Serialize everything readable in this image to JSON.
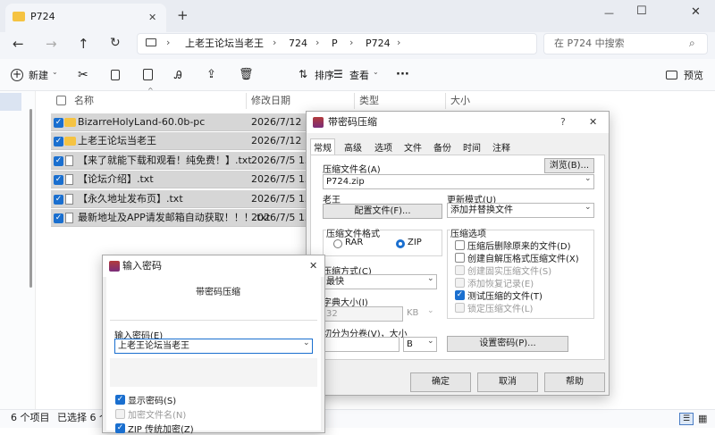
{
  "window": {
    "tab_title": "P724",
    "new_tab": "+",
    "minimize": "—",
    "maximize": "☐",
    "close": "✕"
  },
  "nav": {
    "breadcrumb": [
      "上老王论坛当老王",
      "724",
      "P",
      "P724"
    ],
    "search_placeholder": "在 P724 中搜索"
  },
  "commands": {
    "new": "新建",
    "sort": "排序",
    "view": "查看",
    "more": "···",
    "preview": "预览"
  },
  "columns": {
    "name": "名称",
    "date": "修改日期",
    "type": "类型",
    "size": "大小"
  },
  "files": [
    {
      "name": "BizarreHolyLand-60.0b-pc",
      "date": "2026/7/12 15:",
      "kind": "folder"
    },
    {
      "name": "上老王论坛当老王",
      "date": "2026/7/12 15:",
      "kind": "folder"
    },
    {
      "name": "【来了就能下载和观看！纯免费！】.txt",
      "date": "2026/7/5 13:1",
      "kind": "txt"
    },
    {
      "name": "【论坛介绍】.txt",
      "date": "2026/7/5 13:1",
      "kind": "txt"
    },
    {
      "name": "【永久地址发布页】.txt",
      "date": "2026/7/5 13:1",
      "kind": "txt"
    },
    {
      "name": "最新地址及APP请发邮箱自动获取！！！.txt",
      "date": "2026/7/5 13:1",
      "kind": "txt"
    }
  ],
  "status": {
    "count": "6 个项目",
    "selected": "已选择 6 个"
  },
  "rar": {
    "title": "带密码压缩",
    "help_q": "?",
    "close": "✕",
    "tabs": [
      "常规",
      "高级",
      "选项",
      "文件",
      "备份",
      "时间",
      "注释"
    ],
    "archive_name_label": "压缩文件名(A)",
    "browse": "浏览(B)...",
    "archive_name": "P724.zip",
    "profile_label": "老王",
    "profiles_btn": "配置文件(F)...",
    "update_label": "更新模式(U)",
    "update_value": "添加并替换文件",
    "format_label": "压缩文件格式",
    "format_rar": "RAR",
    "format_zip": "ZIP",
    "options_label": "压缩选项",
    "options": [
      {
        "label": "压缩后删除原来的文件(D)",
        "state": "off"
      },
      {
        "label": "创建自解压格式压缩文件(X)",
        "state": "off"
      },
      {
        "label": "创建固实压缩文件(S)",
        "state": "dis"
      },
      {
        "label": "添加恢复记录(E)",
        "state": "dis"
      },
      {
        "label": "测试压缩的文件(T)",
        "state": "on"
      },
      {
        "label": "锁定压缩文件(L)",
        "state": "dis"
      }
    ],
    "method_label": "压缩方式(C)",
    "method_value": "最快",
    "dict_label": "字典大小(I)",
    "dict_value": "32",
    "dict_unit": "KB",
    "split_label": "切分为分卷(V)，大小",
    "split_unit": "B",
    "set_password": "设置密码(P)...",
    "ok": "确定",
    "cancel": "取消",
    "help": "帮助"
  },
  "pwd": {
    "title": "输入密码",
    "close": "✕",
    "subtitle": "带密码压缩",
    "input_label": "输入密码(E)",
    "input_value": "上老王论坛当老王",
    "show_password": "显示密码(S)",
    "encrypt_names": "加密文件名(N)",
    "zip_legacy": "ZIP 传统加密(Z)"
  }
}
